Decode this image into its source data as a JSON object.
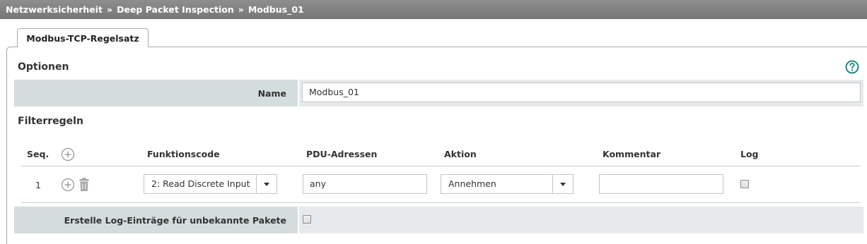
{
  "breadcrumb": [
    "Netzwerksicherheit",
    "Deep Packet Inspection",
    "Modbus_01"
  ],
  "breadcrumb_separator": "»",
  "tab": {
    "label": "Modbus-TCP-Regelsatz"
  },
  "options": {
    "title": "Optionen",
    "name_label": "Name",
    "name_value": "Modbus_01"
  },
  "filter": {
    "title": "Filterregeln",
    "columns": {
      "seq": "Seq.",
      "function_code": "Funktionscode",
      "pdu": "PDU-Adressen",
      "action": "Aktion",
      "comment": "Kommentar",
      "log": "Log"
    },
    "rows": [
      {
        "seq": "1",
        "function_code": "2: Read Discrete Input",
        "pdu": "any",
        "action": "Annehmen",
        "comment": "",
        "log": false
      }
    ]
  },
  "unknown_log": {
    "label": "Erstelle Log-Einträge für unbekannte Pakete",
    "checked": false
  },
  "colors": {
    "breadcrumb_bg": "#828282",
    "label_bg": "#d5dcdc",
    "value_bg": "#e6eaec",
    "help_accent": "#1f8a80"
  },
  "icons": [
    "help-icon",
    "add-icon",
    "trash-icon",
    "caret-down-icon"
  ]
}
